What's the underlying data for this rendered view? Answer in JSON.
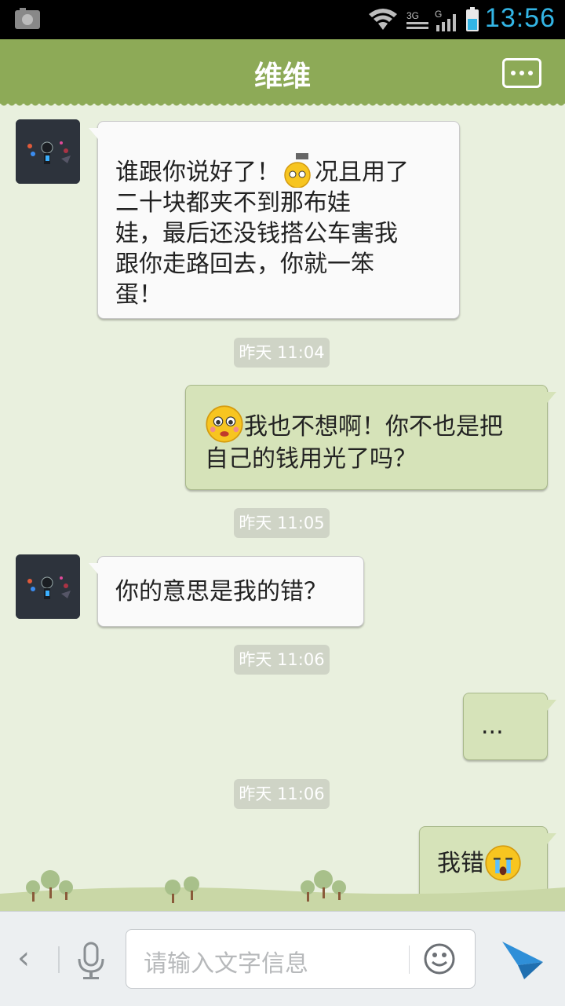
{
  "status_bar": {
    "time": "13:56",
    "network_label": "3G",
    "icons": [
      "android-icon",
      "wifi-icon",
      "network-3g-icon",
      "signal-icon",
      "battery-icon"
    ]
  },
  "header": {
    "title": "维维",
    "menu_icon": "more-options-icon"
  },
  "messages": [
    {
      "from": "them",
      "parts": [
        "谁跟你说好了！",
        "[emoji:sweat-hammer]",
        "况且用了",
        "二十块都夹不到那布娃",
        "娃，最后还没钱搭公车害我",
        "跟你走路回去，你就一笨",
        "蛋！"
      ]
    },
    {
      "timestamp": "昨天 11:04"
    },
    {
      "from": "me",
      "parts": [
        "[emoji:sad]",
        "我也不想啊！你不也是把",
        "自己的钱用光了吗？"
      ]
    },
    {
      "timestamp": "昨天 11:05"
    },
    {
      "from": "them",
      "parts": [
        "你的意思是我的错？"
      ]
    },
    {
      "timestamp": "昨天 11:06"
    },
    {
      "from": "me",
      "parts": [
        "..."
      ]
    },
    {
      "timestamp": "昨天 11:06"
    },
    {
      "from": "me",
      "parts": [
        "我错",
        "[emoji:crying]"
      ]
    }
  ],
  "bubbles": {
    "m1": {
      "l1": "谁跟你说好了！",
      "l1b": "况且用了",
      "l2": "二十块都夹不到那布娃",
      "l3": "娃，最后还没钱搭公车害我",
      "l4": "跟你走路回去，你就一笨",
      "l5": "蛋！"
    },
    "ts1": "昨天 11:04",
    "m2": {
      "l1": "我也不想啊！你不也是把",
      "l2": "自己的钱用光了吗？"
    },
    "ts2": "昨天 11:05",
    "m3": "你的意思是我的错？",
    "ts3": "昨天 11:06",
    "m4": "...",
    "ts4": "昨天 11:06",
    "m5": "我错"
  },
  "input_bar": {
    "placeholder": "请输入文字信息",
    "icons": [
      "back-chevron-icon",
      "microphone-icon",
      "emoji-icon",
      "send-icon"
    ]
  },
  "colors": {
    "header_bg": "#8daa57",
    "chat_bg": "#e9f0de",
    "outgoing_bubble": "#d6e3b9",
    "incoming_bubble": "#fafafa",
    "time_blue": "#33b5e5",
    "send_blue": "#2f8fd8"
  }
}
